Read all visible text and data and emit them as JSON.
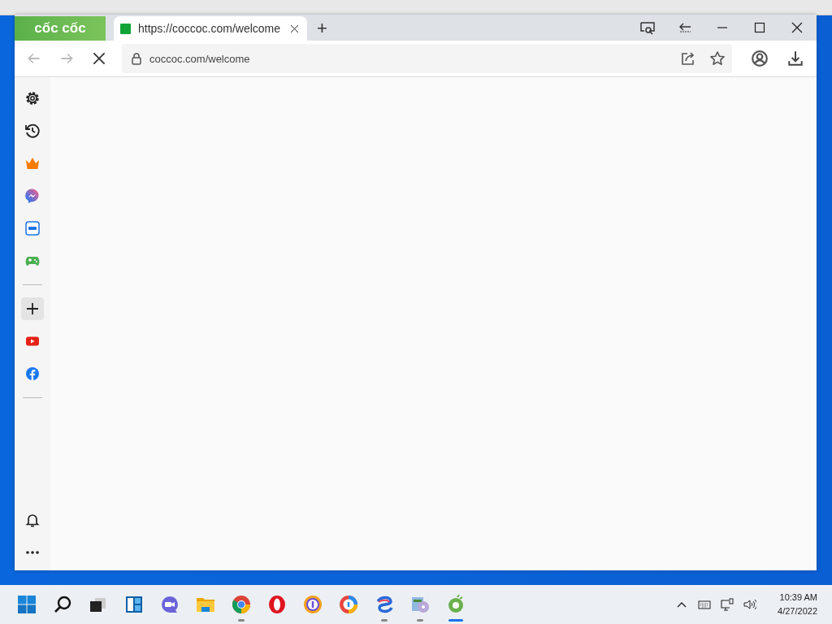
{
  "browser": {
    "logo": "cốc cốc",
    "tabs": [
      {
        "title": "https://coccoc.com/welcome",
        "selected": true
      }
    ],
    "new_tab": "+",
    "titlebar_buttons": [
      {
        "kind": "search-tabs"
      },
      {
        "kind": "back-list"
      },
      {
        "kind": "minimize"
      },
      {
        "kind": "maximize"
      },
      {
        "kind": "close"
      }
    ],
    "toolbar": {
      "back_disabled": true,
      "forward_disabled": true,
      "loading": true,
      "address": "coccoc.com/welcome"
    },
    "address_actions": [
      {
        "kind": "share"
      },
      {
        "kind": "star"
      }
    ],
    "toolbar_actions": [
      {
        "kind": "profile"
      },
      {
        "kind": "download"
      }
    ]
  },
  "sidebar": {
    "items": [
      {
        "kind": "settings"
      },
      {
        "kind": "history"
      },
      {
        "kind": "crown"
      },
      {
        "kind": "messenger"
      },
      {
        "kind": "zalo"
      },
      {
        "kind": "game"
      },
      {
        "kind": "divider"
      },
      {
        "kind": "add"
      },
      {
        "kind": "youtube"
      },
      {
        "kind": "facebook"
      },
      {
        "kind": "divider"
      }
    ],
    "bottom_items": [
      {
        "kind": "bell"
      },
      {
        "kind": "more"
      }
    ]
  },
  "taskbar": {
    "apps": [
      {
        "kind": "start",
        "running": false,
        "selected": false
      },
      {
        "kind": "search",
        "running": false,
        "selected": false
      },
      {
        "kind": "taskview",
        "running": false,
        "selected": false
      },
      {
        "kind": "widgets",
        "running": false,
        "selected": false
      },
      {
        "kind": "chat",
        "running": false,
        "selected": false
      },
      {
        "kind": "folder",
        "running": false,
        "selected": false
      },
      {
        "kind": "chrome",
        "running": true,
        "selected": false
      },
      {
        "kind": "opera",
        "running": false,
        "selected": false
      },
      {
        "kind": "browser-a",
        "running": false,
        "selected": false
      },
      {
        "kind": "browser-b",
        "running": false,
        "selected": false
      },
      {
        "kind": "swirl",
        "running": true,
        "selected": false
      },
      {
        "kind": "installer",
        "running": true,
        "selected": false
      },
      {
        "kind": "coccoc",
        "running": true,
        "selected": true
      }
    ],
    "tray": [
      {
        "kind": "chevron"
      },
      {
        "kind": "keyboard"
      },
      {
        "kind": "network"
      },
      {
        "kind": "volume"
      }
    ],
    "time": "10:39 AM",
    "date": "4/27/2022"
  }
}
